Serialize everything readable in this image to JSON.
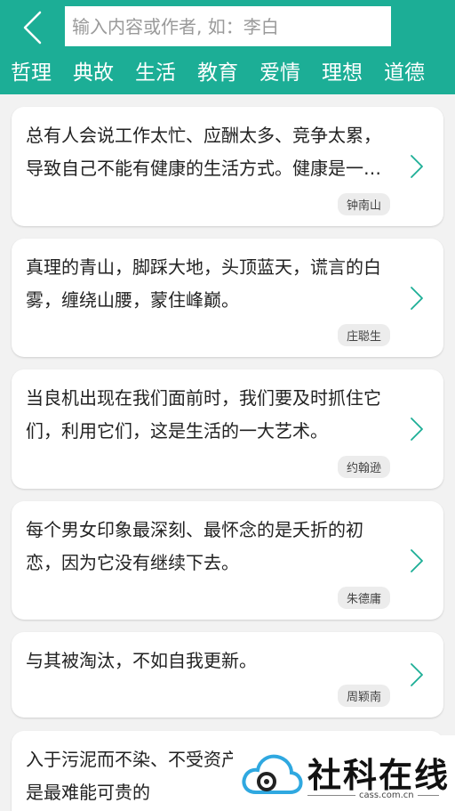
{
  "search": {
    "placeholder": "输入内容或作者, 如：李白"
  },
  "tabs": [
    "哲理",
    "典故",
    "生活",
    "教育",
    "爱情",
    "理想",
    "道德"
  ],
  "quotes": [
    {
      "text": "总有人会说工作太忙、应酬太多、竞争太累，导致自己不能有健康的生活方式。健康是一切的基础。",
      "author": "钟南山"
    },
    {
      "text": "真理的青山，脚踩大地，头顶蓝天，谎言的白雾，缠绕山腰，蒙住峰巅。",
      "author": "庄聪生"
    },
    {
      "text": "当良机出现在我们面前时，我们要及时抓住它们，利用它们，这是生活的一大艺术。",
      "author": "约翰逊"
    },
    {
      "text": "每个男女印象最深刻、最怀念的是夭折的初恋，因为它没有继续下去。",
      "author": "朱德庸"
    },
    {
      "text": "与其被淘汰，不如自我更新。",
      "author": "周颖南"
    },
    {
      "text": "入于污泥而不染、不受资产阶级思想的侵蚀，是最难能可贵的",
      "author": ""
    }
  ],
  "watermark": {
    "title": "社科在线",
    "sub": "cass.com.cn"
  },
  "colors": {
    "accent": "#1cae96",
    "background": "#f2f2f2"
  },
  "icons": {
    "back": "chevron-left-icon",
    "row": "chevron-right-icon"
  }
}
